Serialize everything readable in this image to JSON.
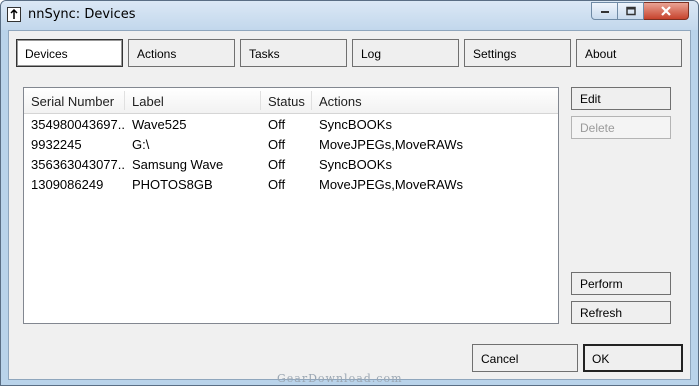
{
  "window": {
    "title": "nnSync: Devices"
  },
  "tabs": [
    {
      "label": "Devices",
      "active": true
    },
    {
      "label": "Actions",
      "active": false
    },
    {
      "label": "Tasks",
      "active": false
    },
    {
      "label": "Log",
      "active": false
    },
    {
      "label": "Settings",
      "active": false
    },
    {
      "label": "About",
      "active": false
    }
  ],
  "devices": {
    "columns": [
      "Serial Number",
      "Label",
      "Status",
      "Actions"
    ],
    "rows": [
      [
        "354980043697...",
        "Wave525",
        "Off",
        "SyncBOOKs"
      ],
      [
        "9932245",
        "G:\\",
        "Off",
        "MoveJPEGs,MoveRAWs"
      ],
      [
        "356363043077...",
        "Samsung Wave",
        "Off",
        "SyncBOOKs"
      ],
      [
        "1309086249",
        "PHOTOS8GB",
        "Off",
        "MoveJPEGs,MoveRAWs"
      ]
    ]
  },
  "side_buttons": {
    "edit": "Edit",
    "delete": "Delete",
    "delete_enabled": false,
    "perform": "Perform",
    "refresh": "Refresh"
  },
  "footer": {
    "cancel": "Cancel",
    "ok": "OK"
  },
  "watermark": "GearDownload.com",
  "icons": [
    "app-icon",
    "minimize-icon",
    "maximize-icon",
    "close-icon"
  ],
  "colors": {
    "title_bar": "#c2d7ec",
    "close_button": "#c7432d",
    "client_bg": "#f0f0f0"
  }
}
